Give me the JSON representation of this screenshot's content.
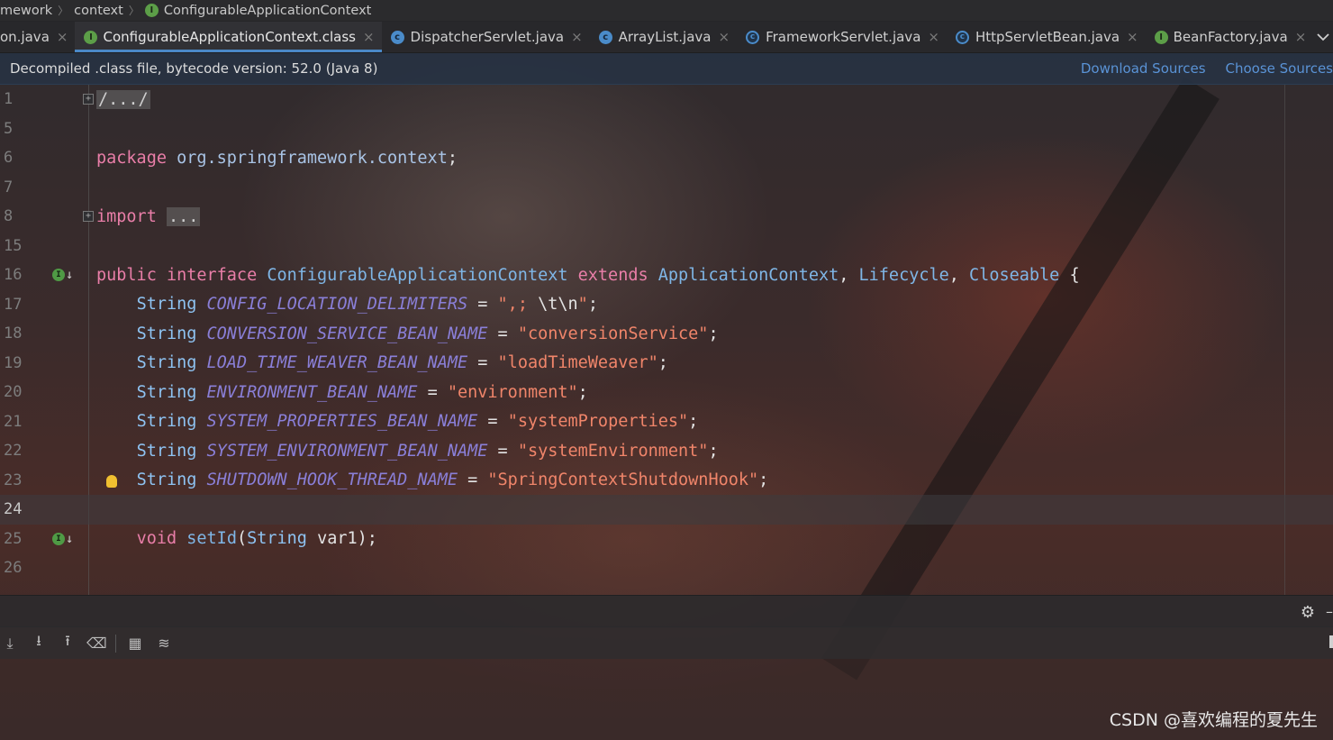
{
  "breadcrumb": [
    "mework",
    "context",
    "ConfigurableApplicationContext"
  ],
  "tabs": [
    {
      "label": "on.java",
      "icon": "file-icon",
      "active": false
    },
    {
      "label": "ConfigurableApplicationContext.class",
      "icon": "interface-icon",
      "active": true
    },
    {
      "label": "DispatcherServlet.java",
      "icon": "class-icon",
      "active": false
    },
    {
      "label": "ArrayList.java",
      "icon": "class-icon",
      "active": false
    },
    {
      "label": "FrameworkServlet.java",
      "icon": "abstract-class-icon",
      "active": false
    },
    {
      "label": "HttpServletBean.java",
      "icon": "abstract-class-icon",
      "active": false
    },
    {
      "label": "BeanFactory.java",
      "icon": "interface-icon",
      "active": false
    }
  ],
  "tab_close_glyph": "×",
  "infobar": {
    "message": "Decompiled .class file, bytecode version: 52.0 (Java 8)",
    "download_sources": "Download Sources",
    "choose_sources": "Choose Sources"
  },
  "editor": {
    "current_line": "24",
    "lines": [
      {
        "n": "1",
        "text": "/.../"
      },
      {
        "n": "5",
        "text": ""
      },
      {
        "n": "6",
        "text": "package org.springframework.context;"
      },
      {
        "n": "7",
        "text": ""
      },
      {
        "n": "8",
        "text": "import ..."
      },
      {
        "n": "15",
        "text": ""
      },
      {
        "n": "16",
        "text": "public interface ConfigurableApplicationContext extends ApplicationContext, Lifecycle, Closeable {"
      },
      {
        "n": "17",
        "text": "String CONFIG_LOCATION_DELIMITERS = \",; \\t\\n\";"
      },
      {
        "n": "18",
        "text": "String CONVERSION_SERVICE_BEAN_NAME = \"conversionService\";"
      },
      {
        "n": "19",
        "text": "String LOAD_TIME_WEAVER_BEAN_NAME = \"loadTimeWeaver\";"
      },
      {
        "n": "20",
        "text": "String ENVIRONMENT_BEAN_NAME = \"environment\";"
      },
      {
        "n": "21",
        "text": "String SYSTEM_PROPERTIES_BEAN_NAME = \"systemProperties\";"
      },
      {
        "n": "22",
        "text": "String SYSTEM_ENVIRONMENT_BEAN_NAME = \"systemEnvironment\";"
      },
      {
        "n": "23",
        "text": "String SHUTDOWN_HOOK_THREAD_NAME = \"SpringContextShutdownHook\";"
      },
      {
        "n": "24",
        "text": ""
      },
      {
        "n": "25",
        "text": "void setId(String var1);"
      },
      {
        "n": "26",
        "text": ""
      }
    ]
  },
  "code": {
    "l1": "/.../",
    "l6_kw": "package",
    "l6_pkg": "org.springframework.context",
    "l6_end": ";",
    "l8_kw": "import",
    "l8_fold": "...",
    "l16_public": "public",
    "l16_interface": "interface",
    "l16_name": "ConfigurableApplicationContext",
    "l16_extends": "extends",
    "l16_t1": "ApplicationContext",
    "l16_t2": "Lifecycle",
    "l16_t3": "Closeable",
    "l16_brace": "{",
    "string_type": "String",
    "c17": "CONFIG_LOCATION_DELIMITERS",
    "v17a": "\",;",
    "v17b": " \\t\\n",
    "v17c": "\"",
    "c18": "CONVERSION_SERVICE_BEAN_NAME",
    "v18": "\"conversionService\"",
    "c19": "LOAD_TIME_WEAVER_BEAN_NAME",
    "v19": "\"loadTimeWeaver\"",
    "c20": "ENVIRONMENT_BEAN_NAME",
    "v20": "\"environment\"",
    "c21": "SYSTEM_PROPERTIES_BEAN_NAME",
    "v21": "\"systemProperties\"",
    "c22": "SYSTEM_ENVIRONMENT_BEAN_NAME",
    "v22": "\"systemEnvironment\"",
    "c23": "SHUTDOWN_HOOK_THREAD_NAME",
    "v23": "\"SpringContextShutdownHook\"",
    "l25_void": "void",
    "l25_method": "setId",
    "l25_open": "(",
    "l25_param_type": "String",
    "l25_param": "var1",
    "l25_close": ");"
  },
  "watermark": "CSDN @喜欢编程的夏先生",
  "colors": {
    "keyword": "#e97ea8",
    "string": "#f0856a",
    "constant": "#8a7fd8",
    "type": "#8ec3f2",
    "link": "#5a93d6",
    "active_tab_underline": "#4a88c7"
  }
}
